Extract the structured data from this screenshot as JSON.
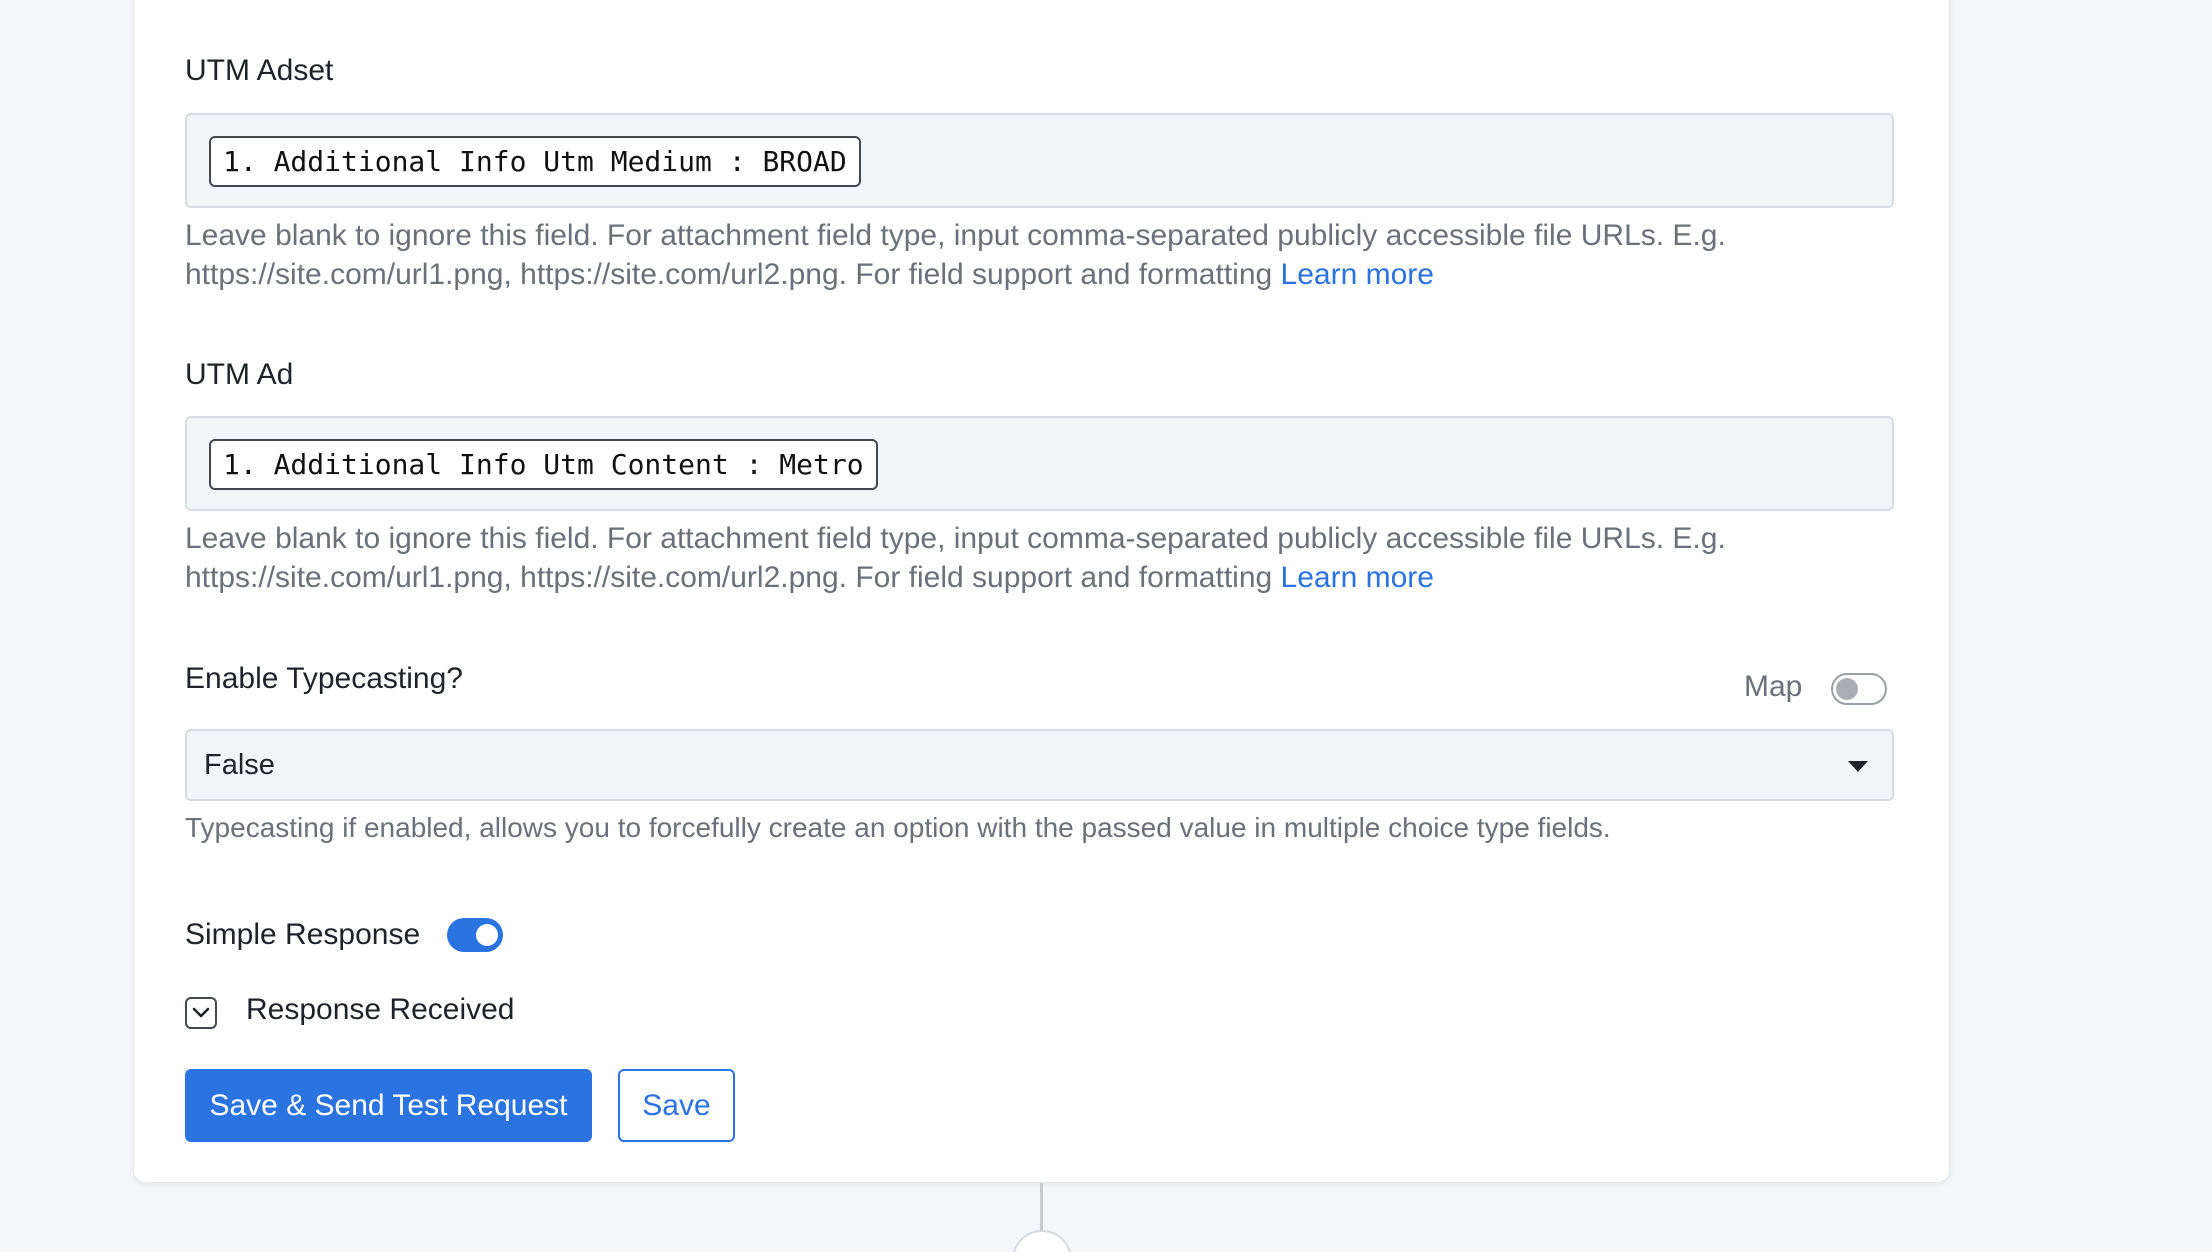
{
  "fields": [
    {
      "label": "UTM Adset",
      "chip": "1. Additional Info Utm Medium : BROAD",
      "help_line1": "Leave blank to ignore this field. For attachment field type, input comma-separated publicly accessible file URLs. E.g.",
      "help_line2": "https://site.com/url1.png, https://site.com/url2.png. For field support and formatting ",
      "help_link": "Learn more"
    },
    {
      "label": "UTM Ad",
      "chip": "1. Additional Info Utm Content : Metro",
      "help_line1": "Leave blank to ignore this field. For attachment field type, input comma-separated publicly accessible file URLs. E.g.",
      "help_line2": "https://site.com/url1.png, https://site.com/url2.png. For field support and formatting ",
      "help_link": "Learn more"
    }
  ],
  "typecasting": {
    "label": "Enable Typecasting?",
    "map_label": "Map",
    "map_enabled": false,
    "selected": "False",
    "help": "Typecasting if enabled, allows you to forcefully create an option with the passed value in multiple choice type fields."
  },
  "simple_response": {
    "label": "Simple Response",
    "enabled": true
  },
  "response_received": {
    "label": "Response Received",
    "icon": "chevron-down-icon"
  },
  "actions": {
    "save_and_test_label": "Save & Send Test Request",
    "save_label": "Save"
  },
  "colors": {
    "accent": "#2b73e0",
    "field_bg": "#f3f6f9",
    "page_bg": "#f4f6f9"
  }
}
